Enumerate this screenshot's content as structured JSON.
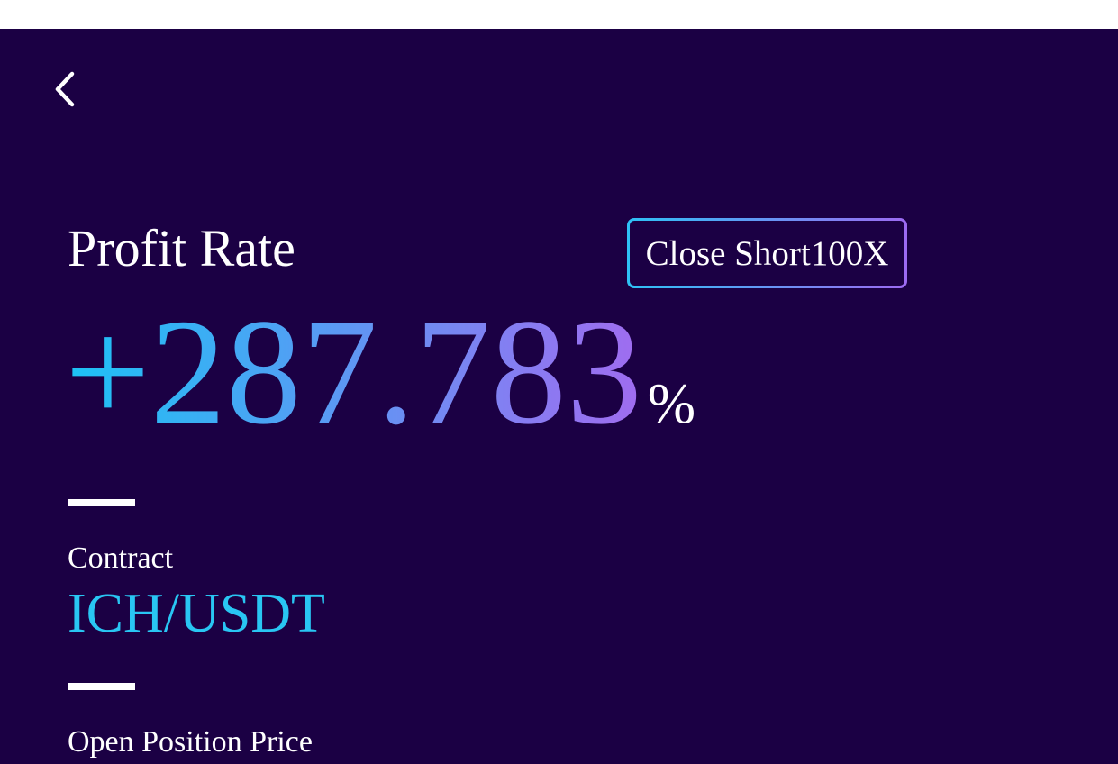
{
  "header": {
    "back_icon": "chevron-left-icon"
  },
  "profit": {
    "label": "Profit Rate",
    "value": "+287.783",
    "unit": "%",
    "badge": "Close Short100X"
  },
  "contract": {
    "label": "Contract",
    "value": "ICH/USDT"
  },
  "open_position": {
    "label": "Open Position Price"
  },
  "colors": {
    "background": "#1b0044",
    "accent_start": "#1cc3f5",
    "accent_end": "#a06cf0",
    "contract_text": "#29c6f3"
  }
}
